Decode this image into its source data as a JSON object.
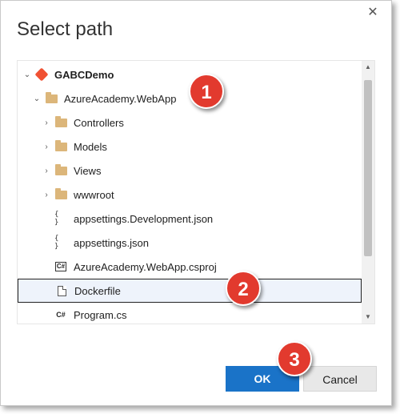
{
  "dialog": {
    "title": "Select path",
    "close_icon": "close-icon",
    "buttons": {
      "ok": "OK",
      "cancel": "Cancel"
    }
  },
  "tree": {
    "items": [
      {
        "label": "GABCDemo",
        "icon": "git-repo-icon",
        "expanded": true
      },
      {
        "label": "AzureAcademy.WebApp",
        "icon": "folder-icon",
        "expanded": true
      },
      {
        "label": "Controllers",
        "icon": "folder-icon",
        "expanded": false
      },
      {
        "label": "Models",
        "icon": "folder-icon",
        "expanded": false
      },
      {
        "label": "Views",
        "icon": "folder-icon",
        "expanded": false
      },
      {
        "label": "wwwroot",
        "icon": "folder-icon",
        "expanded": false
      },
      {
        "label": "appsettings.Development.json",
        "icon": "json-file-icon",
        "icon_text": "{ }"
      },
      {
        "label": "appsettings.json",
        "icon": "json-file-icon",
        "icon_text": "{ }"
      },
      {
        "label": "AzureAcademy.WebApp.csproj",
        "icon": "csproj-file-icon",
        "icon_text": "C#"
      },
      {
        "label": "Dockerfile",
        "icon": "file-icon",
        "selected": true
      },
      {
        "label": "Program.cs",
        "icon": "csharp-file-icon",
        "icon_text": "C#"
      }
    ]
  },
  "annotations": {
    "step1": "1",
    "step2": "2",
    "step3": "3"
  },
  "colors": {
    "accent": "#1a73c8",
    "badge": "#e23a2e",
    "folder": "#dcb67a",
    "git": "#f05133"
  }
}
